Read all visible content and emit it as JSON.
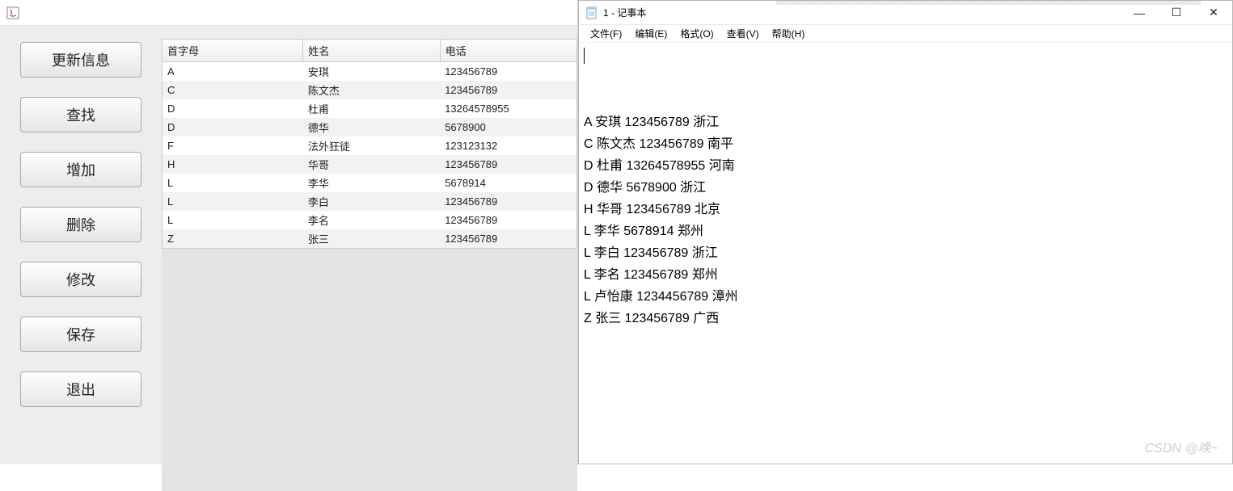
{
  "java_app": {
    "buttons": {
      "update": "更新信息",
      "find": "查找",
      "add": "增加",
      "delete": "删除",
      "modify": "修改",
      "save": "保存",
      "exit": "退出"
    },
    "table": {
      "headers": {
        "initial": "首字母",
        "name": "姓名",
        "phone": "电话"
      },
      "rows": [
        {
          "initial": "A",
          "name": "安琪",
          "phone": "123456789"
        },
        {
          "initial": "C",
          "name": "陈文杰",
          "phone": "123456789"
        },
        {
          "initial": "D",
          "name": "杜甫",
          "phone": "13264578955"
        },
        {
          "initial": "D",
          "name": "德华",
          "phone": "5678900"
        },
        {
          "initial": "F",
          "name": "法外狂徒",
          "phone": "123123132"
        },
        {
          "initial": "H",
          "name": "华哥",
          "phone": "123456789"
        },
        {
          "initial": "L",
          "name": "李华",
          "phone": "5678914"
        },
        {
          "initial": "L",
          "name": "李白",
          "phone": "123456789"
        },
        {
          "initial": "L",
          "name": "李名",
          "phone": "123456789"
        },
        {
          "initial": "Z",
          "name": "张三",
          "phone": "123456789"
        }
      ]
    }
  },
  "notepad": {
    "title": "1 - 记事本",
    "menu": {
      "file": "文件(F)",
      "edit": "编辑(E)",
      "format": "格式(O)",
      "view": "查看(V)",
      "help": "帮助(H)"
    },
    "lines": [
      "A 安琪 123456789 浙江",
      "C 陈文杰 123456789 南平",
      "D 杜甫 13264578955 河南",
      "D 德华 5678900 浙江",
      "H 华哥 123456789 北京",
      "L 李华 5678914 郑州",
      "L 李白 123456789 浙江",
      "L 李名 123456789 郑州",
      "L 卢怡康 1234456789 漳州",
      "Z 张三 123456789 广西"
    ]
  },
  "watermark": "CSDN @唤~"
}
